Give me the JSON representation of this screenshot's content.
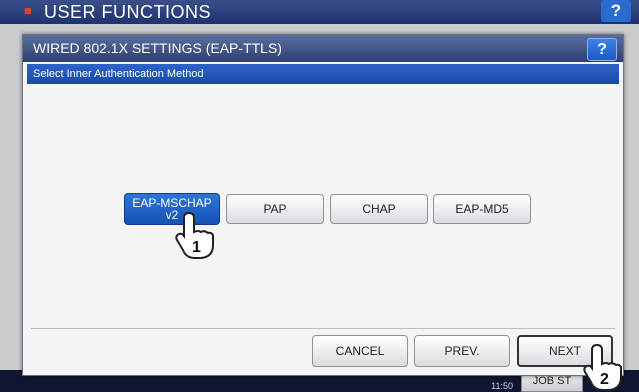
{
  "background": {
    "title": "USER FUNCTIONS",
    "help_label": "?",
    "clock": "11:50",
    "job_status_label": "JOB ST"
  },
  "dialog": {
    "title": "WIRED 802.1X SETTINGS (EAP-TTLS)",
    "help_label": "?",
    "subheading": "Select Inner Authentication Method",
    "methods": [
      {
        "line1": "EAP-MSCHAP",
        "line2": "v2",
        "selected": true
      },
      {
        "label": "PAP",
        "selected": false
      },
      {
        "label": "CHAP",
        "selected": false
      },
      {
        "label": "EAP-MD5",
        "selected": false
      }
    ],
    "footer": {
      "cancel_label": "CANCEL",
      "prev_label": "PREV.",
      "next_label": "NEXT"
    },
    "step_markers": [
      "1",
      "2"
    ]
  },
  "colors": {
    "accent": "#1553b5",
    "title_bar": "#2d3f73",
    "subheading_bar": "#1a4aa8"
  }
}
